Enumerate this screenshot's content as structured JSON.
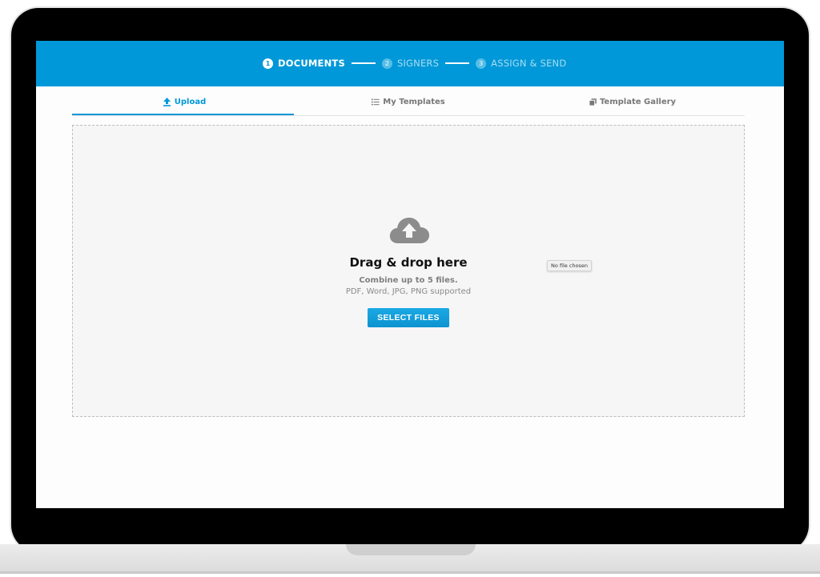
{
  "stepper": {
    "steps": [
      {
        "number": "1",
        "label": "DOCUMENTS",
        "state": "active"
      },
      {
        "number": "2",
        "label": "SIGNERS",
        "state": "inactive"
      },
      {
        "number": "3",
        "label": "ASSIGN & SEND",
        "state": "inactive"
      }
    ]
  },
  "tabs": [
    {
      "label": "Upload",
      "icon": "upload-icon",
      "active": true
    },
    {
      "label": "My Templates",
      "icon": "list-icon",
      "active": false
    },
    {
      "label": "Template Gallery",
      "icon": "gallery-icon",
      "active": false
    }
  ],
  "dropzone": {
    "icon": "cloud-upload-icon",
    "title": "Drag & drop here",
    "subtitle": "Combine up to 5 files.",
    "formats": "PDF, Word, JPG, PNG supported",
    "button_label": "SELECT FILES",
    "file_status": "No file chosen"
  },
  "colors": {
    "brand": "#0098d8",
    "dropzone_bg": "#f6f6f6"
  }
}
